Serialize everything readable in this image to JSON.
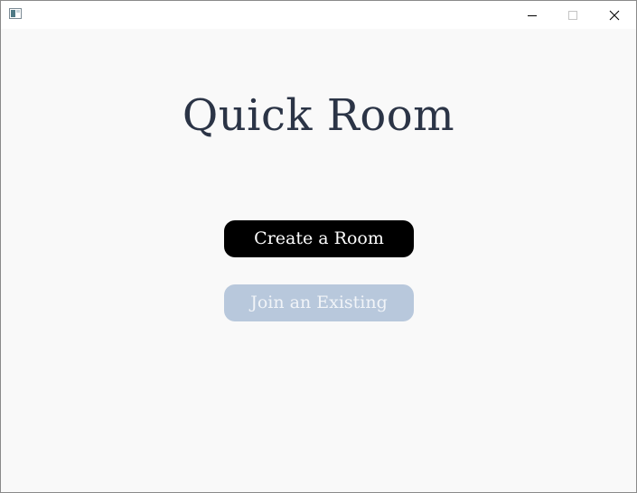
{
  "window": {
    "icon": "app-window-icon",
    "controls": {
      "minimize_icon": "minimize-icon",
      "maximize_icon": "maximize-icon",
      "close_icon": "close-icon"
    }
  },
  "main": {
    "title": "Quick Room",
    "create_button_label": "Create a Room",
    "join_button_label": "Join an Existing",
    "join_button_state": "disabled"
  },
  "colors": {
    "title_text": "#2b3446",
    "create_button_bg": "#000000",
    "join_button_bg": "#b8c8dc",
    "background": "#f9f9f9"
  }
}
